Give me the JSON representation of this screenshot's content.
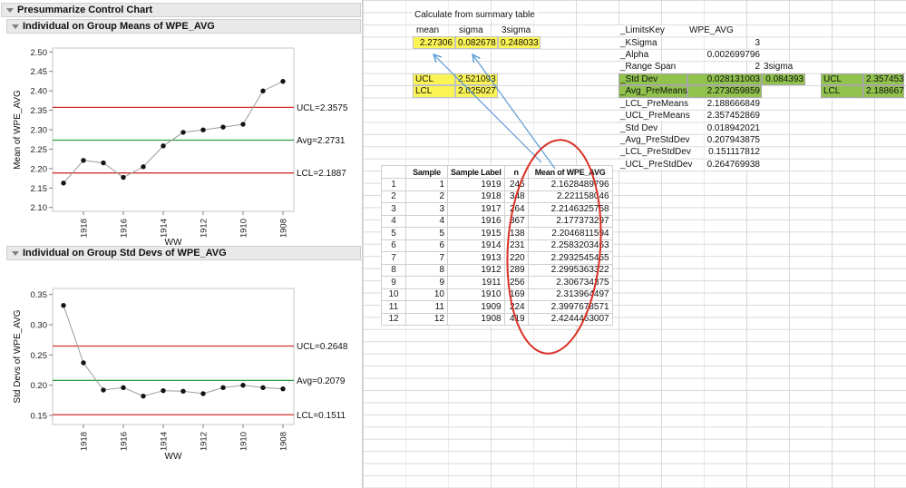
{
  "report": {
    "title": "Presummarize Control Chart",
    "sections": {
      "means_title": "Individual on Group Means of WPE_AVG",
      "stddev_title": "Individual on Group Std Devs of WPE_AVG"
    }
  },
  "chart_data": [
    {
      "type": "line",
      "title": "Individual on Group Means of WPE_AVG",
      "xlabel": "WW",
      "ylabel": "Mean of WPE_AVG",
      "categories": [
        "1919",
        "1918",
        "1917",
        "1916",
        "1915",
        "1914",
        "1913",
        "1912",
        "1911",
        "1910",
        "1909",
        "1908"
      ],
      "x_ticks": [
        "1918",
        "1916",
        "1914",
        "1912",
        "1910",
        "1908"
      ],
      "values": [
        2.16285,
        2.22116,
        2.21463,
        2.17737,
        2.20468,
        2.25832,
        2.29325,
        2.29954,
        2.30673,
        2.31396,
        2.39977,
        2.42445
      ],
      "ylim": [
        2.09,
        2.51
      ],
      "yticks": [
        "2.10",
        "2.15",
        "2.20",
        "2.25",
        "2.30",
        "2.35",
        "2.40",
        "2.45",
        "2.50"
      ],
      "limits": [
        {
          "name": "ucl",
          "label": "UCL=2.3575",
          "value": 2.3575,
          "color": "#d2302e"
        },
        {
          "name": "avg",
          "label": "Avg=2.2731",
          "value": 2.2731,
          "color": "#2f9e44"
        },
        {
          "name": "lcl",
          "label": "LCL=2.1887",
          "value": 2.1887,
          "color": "#d2302e"
        }
      ],
      "legend": "none",
      "grid": "off"
    },
    {
      "type": "line",
      "title": "Individual on Group Std Devs of WPE_AVG",
      "xlabel": "WW",
      "ylabel": "Std Devs of WPE_AVG",
      "categories": [
        "1919",
        "1918",
        "1917",
        "1916",
        "1915",
        "1914",
        "1913",
        "1912",
        "1911",
        "1910",
        "1909",
        "1908"
      ],
      "x_ticks": [
        "1918",
        "1916",
        "1914",
        "1912",
        "1910",
        "1908"
      ],
      "values": [
        0.332,
        0.237,
        0.192,
        0.196,
        0.182,
        0.191,
        0.19,
        0.186,
        0.196,
        0.2,
        0.196,
        0.194
      ],
      "ylim": [
        0.135,
        0.36
      ],
      "yticks": [
        "0.15",
        "0.20",
        "0.25",
        "0.30",
        "0.35"
      ],
      "limits": [
        {
          "name": "ucl",
          "label": "UCL=0.2648",
          "value": 0.2648,
          "color": "#d2302e"
        },
        {
          "name": "avg",
          "label": "Avg=0.2079",
          "value": 0.2079,
          "color": "#2f9e44"
        },
        {
          "name": "lcl",
          "label": "LCL=0.1511",
          "value": 0.1511,
          "color": "#d2302e"
        }
      ],
      "legend": "none",
      "grid": "off"
    }
  ],
  "summary": {
    "caption": "Calculate from summary table",
    "headers": [
      "mean",
      "sigma",
      "3sigma"
    ],
    "values": [
      "2.27306",
      "0.082678",
      "0.248033"
    ],
    "ucl_label": "UCL",
    "ucl_value": "2.521093",
    "lcl_label": "LCL",
    "lcl_value": "2.025027"
  },
  "sample_table": {
    "headers": [
      "",
      "Sample",
      "Sample Label",
      "n",
      "Mean of WPE_AVG"
    ],
    "rows": [
      [
        "1",
        "1",
        "1919",
        "245",
        "2.1628489796"
      ],
      [
        "2",
        "2",
        "1918",
        "348",
        "2.221158046"
      ],
      [
        "3",
        "3",
        "1917",
        "264",
        "2.2146325758"
      ],
      [
        "4",
        "4",
        "1916",
        "367",
        "2.177373297"
      ],
      [
        "5",
        "5",
        "1915",
        "138",
        "2.2046811594"
      ],
      [
        "6",
        "6",
        "1914",
        "231",
        "2.2583203463"
      ],
      [
        "7",
        "7",
        "1913",
        "220",
        "2.2932545455"
      ],
      [
        "8",
        "8",
        "1912",
        "289",
        "2.2995363322"
      ],
      [
        "9",
        "9",
        "1911",
        "256",
        "2.306734375"
      ],
      [
        "10",
        "10",
        "1910",
        "169",
        "2.313964497"
      ],
      [
        "11",
        "11",
        "1909",
        "224",
        "2.3997678571"
      ],
      [
        "12",
        "12",
        "1908",
        "419",
        "2.4244463007"
      ]
    ]
  },
  "limits_panel": {
    "rows": [
      {
        "cells": [
          "_LimitsKey",
          "WPE_AVG",
          ""
        ],
        "hl": [
          false,
          false,
          false
        ]
      },
      {
        "cells": [
          "_KSigma",
          "3",
          ""
        ],
        "hl": [
          false,
          false,
          false
        ]
      },
      {
        "cells": [
          "_Alpha",
          "0.002699796",
          ""
        ],
        "hl": [
          false,
          false,
          false
        ]
      },
      {
        "cells": [
          "_Range Span",
          "2",
          "3sigma"
        ],
        "hl": [
          false,
          false,
          false
        ]
      },
      {
        "cells": [
          "_Std Dev",
          "0.028131003",
          "0.084393"
        ],
        "hl": [
          true,
          true,
          true
        ]
      },
      {
        "cells": [
          "_Avg_PreMeans",
          "2.273059859",
          ""
        ],
        "hl": [
          true,
          true,
          false
        ]
      },
      {
        "cells": [
          "_LCL_PreMeans",
          "2.188666849",
          ""
        ],
        "hl": [
          false,
          false,
          false
        ]
      },
      {
        "cells": [
          "_UCL_PreMeans",
          "2.357452869",
          ""
        ],
        "hl": [
          false,
          false,
          false
        ]
      },
      {
        "cells": [
          "_Std Dev",
          "0.018942021",
          ""
        ],
        "hl": [
          false,
          false,
          false
        ]
      },
      {
        "cells": [
          "_Avg_PreStdDev",
          "0.207943875",
          ""
        ],
        "hl": [
          false,
          false,
          false
        ]
      },
      {
        "cells": [
          "_LCL_PreStdDev",
          "0.151117812",
          ""
        ],
        "hl": [
          false,
          false,
          false
        ]
      },
      {
        "cells": [
          "_UCL_PreStdDev",
          "0.264769938",
          ""
        ],
        "hl": [
          false,
          false,
          false
        ]
      }
    ]
  },
  "side_limits": {
    "ucl_label": "UCL",
    "ucl_value": "2.357453",
    "lcl_label": "LCL",
    "lcl_value": "2.188667"
  },
  "colors": {
    "highlight_yellow": "#fbf455",
    "highlight_green": "#90c24c",
    "limit_red": "#d2302e",
    "avg_green": "#2f9e44",
    "arrow_blue": "#5b9bd5",
    "ellipse_red": "#d93025"
  }
}
